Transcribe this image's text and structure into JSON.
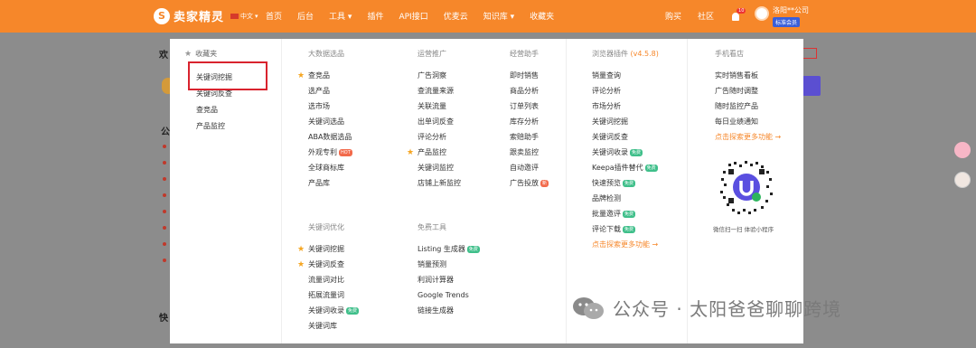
{
  "header": {
    "logo_text": "卖家精灵",
    "lang": "中文",
    "nav": [
      "首页",
      "后台",
      "工具",
      "插件",
      "API接口",
      "优麦云",
      "知识库",
      "收藏夹"
    ],
    "right": [
      "购买",
      "社区"
    ],
    "notif_count": "10",
    "user_name": "洛阳**公司",
    "member_badge": "标准会员"
  },
  "favorites": {
    "title": "收藏夹",
    "items": [
      "关键词挖掘",
      "关键词反查",
      "查竞品",
      "产品监控"
    ]
  },
  "columns": {
    "big_data": {
      "title": "大数据选品",
      "items": [
        {
          "label": "查竞品",
          "star": true
        },
        {
          "label": "选产品",
          "star": false
        },
        {
          "label": "选市场",
          "star": false
        },
        {
          "label": "关键词选品",
          "star": false
        },
        {
          "label": "ABA数据选品",
          "star": false
        },
        {
          "label": "外观专利",
          "star": false,
          "tag": "HOT"
        },
        {
          "label": "全球商标库",
          "star": false
        },
        {
          "label": "产品库",
          "star": false
        }
      ]
    },
    "ops": {
      "title": "运营推广",
      "items": [
        {
          "label": "广告洞察",
          "star": false
        },
        {
          "label": "查流量来源",
          "star": false
        },
        {
          "label": "关联流量",
          "star": false
        },
        {
          "label": "出单词反查",
          "star": false
        },
        {
          "label": "评论分析",
          "star": false
        },
        {
          "label": "产品监控",
          "star": true
        },
        {
          "label": "关键词监控",
          "star": false
        },
        {
          "label": "店铺上新监控",
          "star": false
        }
      ]
    },
    "assistant": {
      "title": "经营助手",
      "items": [
        {
          "label": "即时销售"
        },
        {
          "label": "商品分析"
        },
        {
          "label": "订单列表"
        },
        {
          "label": "库存分析"
        },
        {
          "label": "索赔助手"
        },
        {
          "label": "跟卖监控"
        },
        {
          "label": "自动邀评"
        },
        {
          "label": "广告投放",
          "tag": "新"
        }
      ]
    },
    "plugin": {
      "title": "浏览器插件",
      "version": "(v4.5.8)",
      "items": [
        {
          "label": "销量查询"
        },
        {
          "label": "评论分析"
        },
        {
          "label": "市场分析"
        },
        {
          "label": "关键词挖掘"
        },
        {
          "label": "关键词反查"
        },
        {
          "label": "关键词收录",
          "tag": "免费"
        },
        {
          "label": "Keepa插件替代",
          "tag": "免费"
        },
        {
          "label": "快速预览",
          "tag": "免费"
        },
        {
          "label": "品牌检测"
        },
        {
          "label": "批量邀评",
          "tag": "免费"
        },
        {
          "label": "评论下载",
          "tag": "免费"
        }
      ],
      "more": "点击探索更多功能 →"
    },
    "mobile": {
      "title": "手机看店",
      "items": [
        "实时销售看板",
        "广告随时调整",
        "随时监控产品",
        "每日业绩通知"
      ],
      "more": "点击探索更多功能 →",
      "qr_caption": "微信扫一扫 体验小程序"
    },
    "keyword": {
      "title": "关键词优化",
      "items": [
        {
          "label": "关键词挖掘",
          "star": true
        },
        {
          "label": "关键词反查",
          "star": true
        },
        {
          "label": "流量词对比",
          "star": false
        },
        {
          "label": "拓展流量词",
          "star": false
        },
        {
          "label": "关键词收录",
          "star": false,
          "tag": "免费"
        },
        {
          "label": "关键词库",
          "star": false
        }
      ]
    },
    "free": {
      "title": "免费工具",
      "items": [
        {
          "label": "Listing 生成器",
          "tag": "免费"
        },
        {
          "label": "销量预测"
        },
        {
          "label": "利润计算器"
        },
        {
          "label": "Google Trends"
        },
        {
          "label": "链接生成器"
        }
      ]
    }
  },
  "watermark": "公众号 · 太阳爸爸聊聊跨境",
  "background": {
    "partial_texts": [
      "欢",
      "公",
      "快"
    ]
  },
  "colors": {
    "brand_orange": "#f6872a",
    "badge_blue": "#3a5fd9",
    "highlight_red": "#d9232e",
    "star": "#f5a623"
  }
}
